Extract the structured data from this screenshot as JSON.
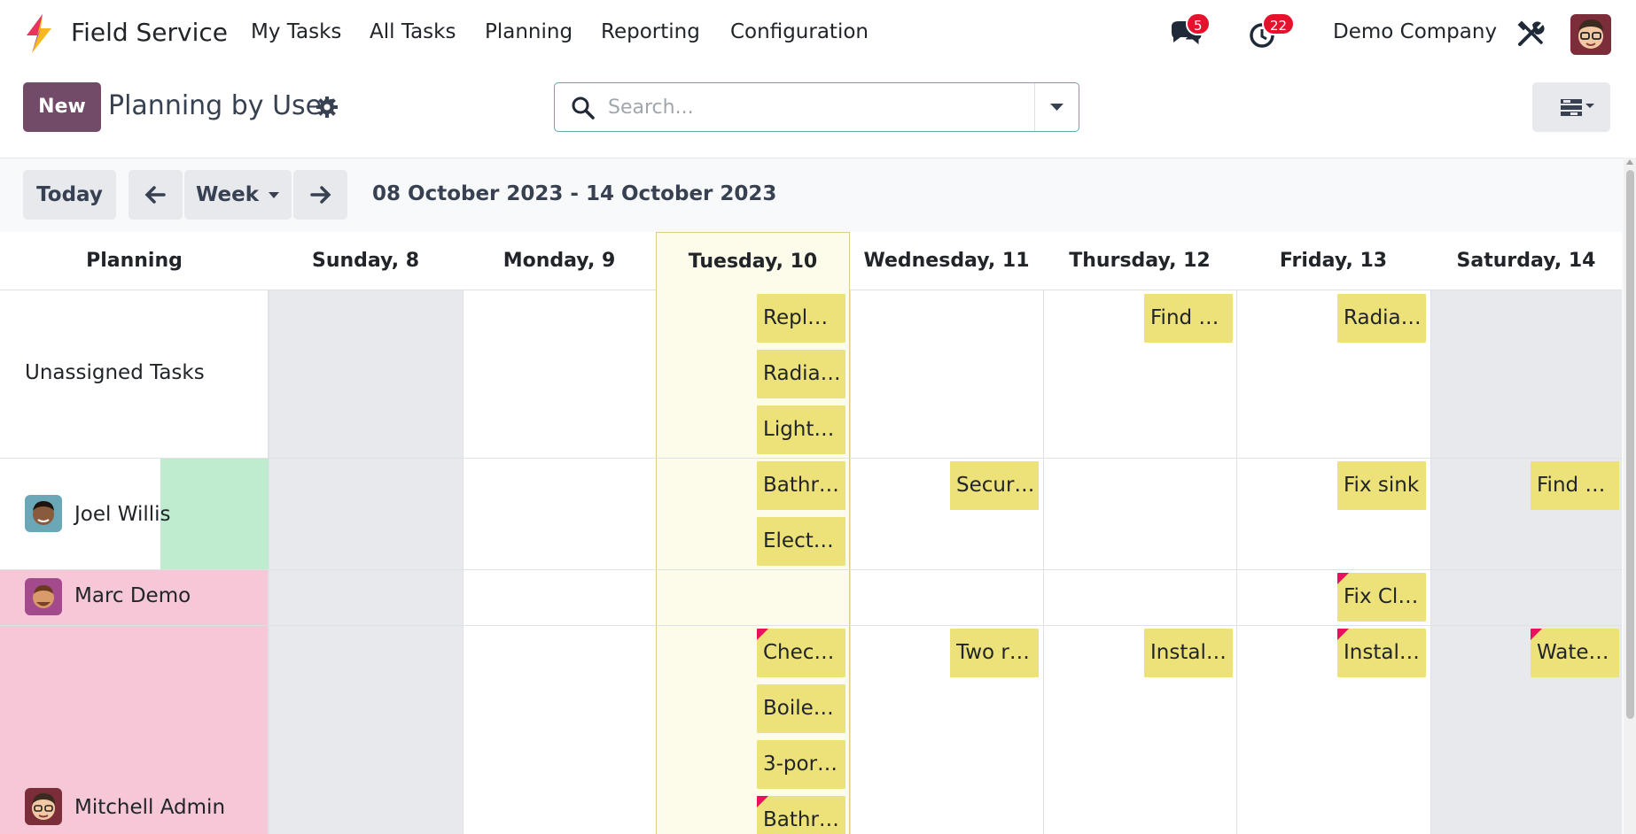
{
  "navbar": {
    "app_name": "Field Service",
    "menu": [
      "My Tasks",
      "All Tasks",
      "Planning",
      "Reporting",
      "Configuration"
    ],
    "messages_count": "5",
    "activities_count": "22",
    "company": "Demo Company",
    "icons": [
      "field-service-logo",
      "chat-icon",
      "clock-icon",
      "tools-icon",
      "user-avatar"
    ]
  },
  "control_panel": {
    "new_label": "New",
    "title": "Planning by User",
    "search_placeholder": "Search...",
    "view_switcher_icon": "gantt-view-icon"
  },
  "calendar": {
    "today_label": "Today",
    "scale_label": "Week",
    "date_range": "08 October 2023 - 14 October 2023",
    "columns": [
      "Planning",
      "Sunday, 8",
      "Monday, 9",
      "Tuesday, 10",
      "Wednesday, 11",
      "Thursday, 12",
      "Friday, 13",
      "Saturday, 14"
    ],
    "today_column": "Tuesday, 10",
    "rows": [
      {
        "label": "Unassigned Tasks",
        "avatar": false
      },
      {
        "label": "Joel Willis",
        "avatar": true
      },
      {
        "label": "Marc Demo",
        "avatar": true
      },
      {
        "label": "Mitchell Admin",
        "avatar": true
      }
    ],
    "tasks": {
      "unassigned": {
        "tuesday": [
          "Repl…",
          "Radia…",
          "Light…"
        ],
        "thursday": [
          "Find …"
        ],
        "friday": [
          "Radia…"
        ]
      },
      "joel": {
        "tuesday": [
          "Bathr…",
          "Elect…"
        ],
        "wednesday": [
          "Secur…"
        ],
        "friday": [
          "Fix sink"
        ],
        "saturday": [
          "Find …"
        ]
      },
      "marc": {
        "friday": [
          "Fix Cl…"
        ]
      },
      "mitchell": {
        "tuesday": [
          "Chec…",
          "Boile…",
          "3-por…",
          "Bathr…"
        ],
        "wednesday": [
          "Two r…"
        ],
        "thursday": [
          "Instal…"
        ],
        "friday": [
          "Instal…"
        ],
        "saturday": [
          "Wate…"
        ]
      }
    },
    "colors": {
      "task_bg": "#ede17a",
      "today_bg": "#fdfbea",
      "today_border": "#e3c98a",
      "weekend_bg": "#e7e9ed",
      "overload_bg": "#f6c7d6",
      "available_bg": "#bfeccf",
      "deadline_flag": "#e8115e",
      "primary": "#714b67"
    }
  }
}
